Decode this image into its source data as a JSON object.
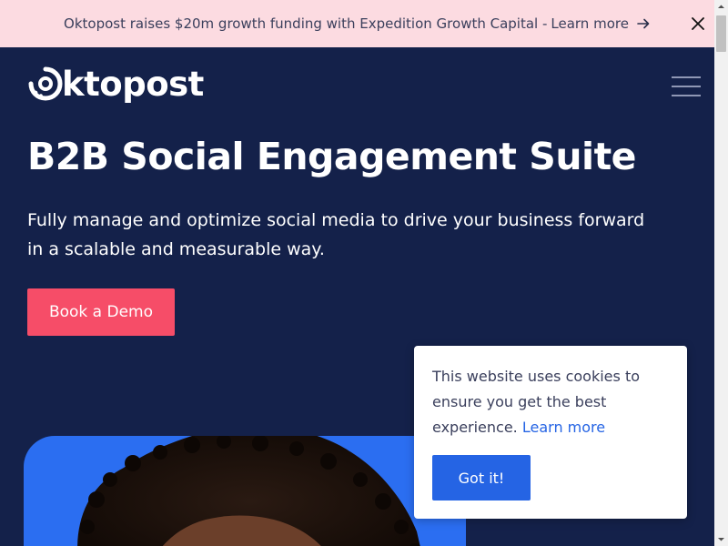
{
  "announcement": {
    "text": "Oktopost raises $20m growth funding with Expedition Growth Capital - ",
    "link_label": "Learn more",
    "arrow_icon": "arrow-right-icon",
    "close_icon": "close-icon"
  },
  "header": {
    "logo_text": "ktopost",
    "menu_icon": "hamburger-menu-icon"
  },
  "hero": {
    "title": "B2B Social Engagement Suite",
    "subtitle": "Fully manage and optimize social media to drive your business forward in a scalable and measurable way.",
    "cta_label": "Book a Demo"
  },
  "cookie_banner": {
    "message": "This website uses cookies to ensure you get the best experience. ",
    "link_label": "Learn more",
    "accept_label": "Got it!"
  },
  "colors": {
    "brand_navy": "#14214a",
    "cta_red": "#f64d68",
    "accent_blue": "#2564e4",
    "announce_pink": "#fcdbe1",
    "image_blue": "#2b6ef1"
  }
}
